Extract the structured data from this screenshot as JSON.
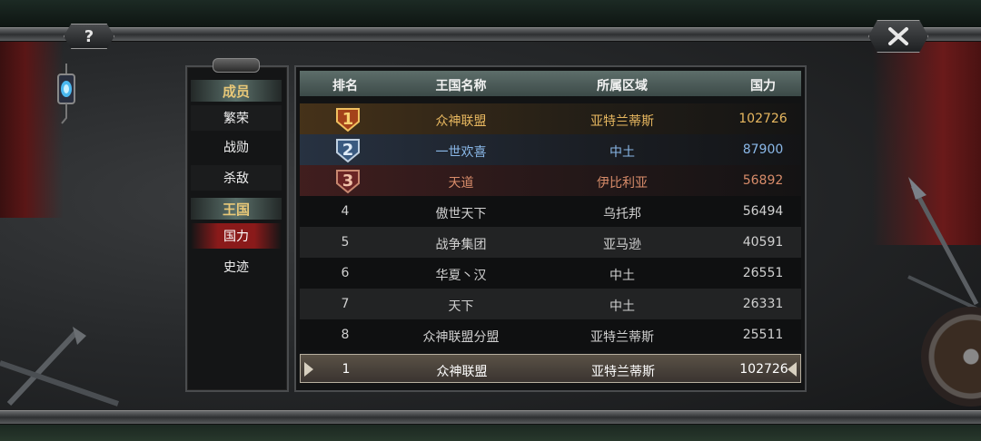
{
  "topbar": {
    "help_label": "?",
    "close_icon": "close-x-icon"
  },
  "menu": {
    "sections": [
      {
        "header": "成员",
        "items": [
          "繁荣",
          "战勋",
          "杀敌"
        ]
      },
      {
        "header": "王国",
        "items": [
          "国力",
          "史迹"
        ]
      }
    ],
    "active": "国力"
  },
  "table": {
    "headers": [
      "排名",
      "王国名称",
      "所属区域",
      "国力"
    ],
    "rows": [
      {
        "rank": "1",
        "name": "众神联盟",
        "region": "亚特兰蒂斯",
        "power": "102726",
        "medal": "gold-medal-icon"
      },
      {
        "rank": "2",
        "name": "一世欢喜",
        "region": "中土",
        "power": "87900",
        "medal": "silver-medal-icon"
      },
      {
        "rank": "3",
        "name": "天道",
        "region": "伊比利亚",
        "power": "56892",
        "medal": "bronze-medal-icon"
      },
      {
        "rank": "4",
        "name": "傲世天下",
        "region": "乌托邦",
        "power": "56494"
      },
      {
        "rank": "5",
        "name": "战争集团",
        "region": "亚马逊",
        "power": "40591"
      },
      {
        "rank": "6",
        "name": "华夏丶汉",
        "region": "中土",
        "power": "26551"
      },
      {
        "rank": "7",
        "name": "天下",
        "region": "中土",
        "power": "26331"
      },
      {
        "rank": "8",
        "name": "众神联盟分盟",
        "region": "亚特兰蒂斯",
        "power": "25511"
      }
    ],
    "my_row": {
      "rank": "1",
      "name": "众神联盟",
      "region": "亚特兰蒂斯",
      "power": "102726"
    }
  },
  "colors": {
    "gold": "#e8b860",
    "silver": "#8ab8e8",
    "bronze": "#d88c6a",
    "accent_red": "#8a1a1a"
  }
}
